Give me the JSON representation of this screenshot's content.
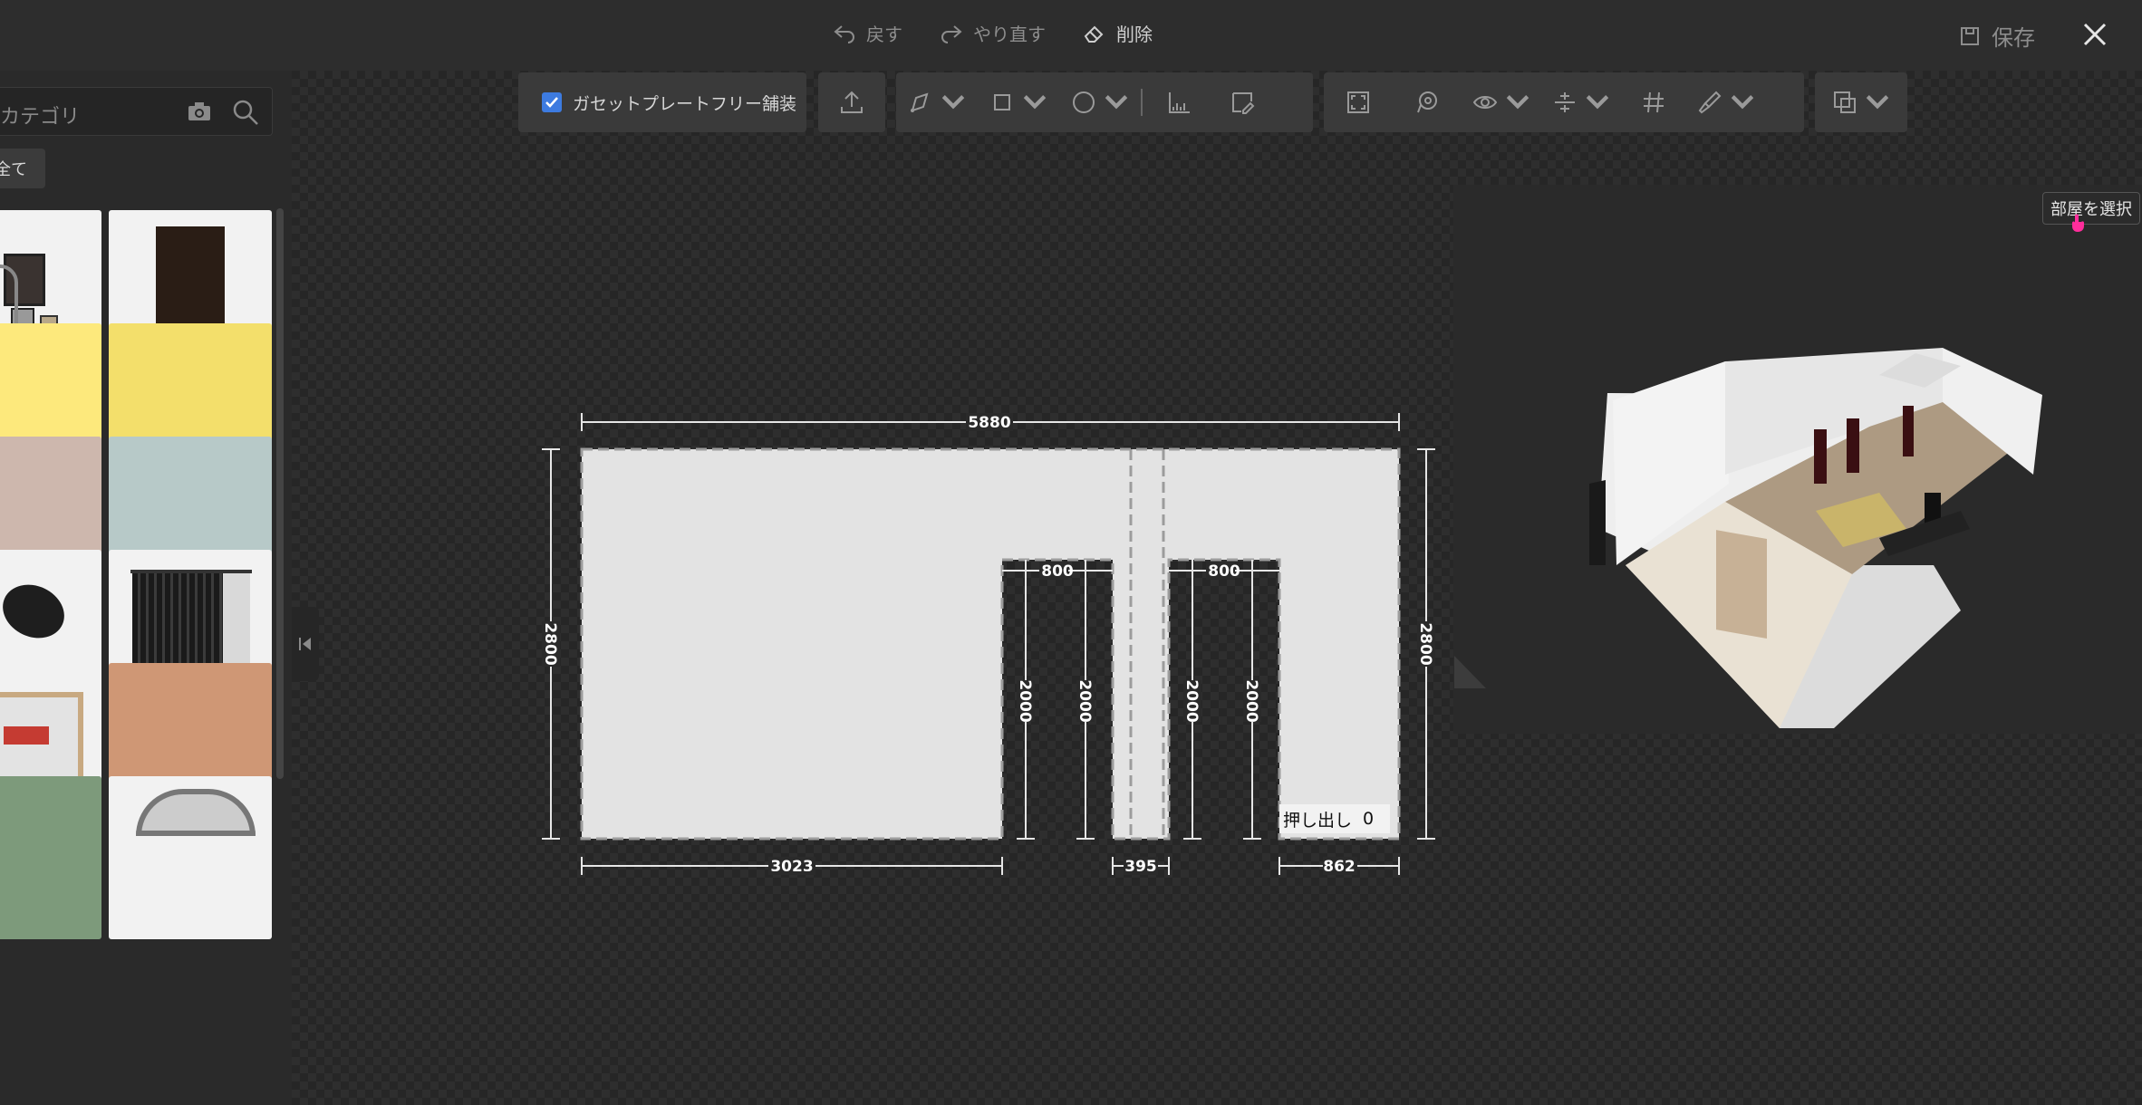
{
  "topbar": {
    "undo_label": "戻す",
    "redo_label": "やり直す",
    "delete_label": "削除",
    "save_label": "保存"
  },
  "sidebar": {
    "search_placeholder": "カテゴリ",
    "chip_label": "全て"
  },
  "toolbar": {
    "gusset_label": "ガセットプレートフリー舗装",
    "gusset_checked": true
  },
  "preview": {
    "room_select_label": "部屋を選択"
  },
  "plan": {
    "top_width": "5880",
    "left_height": "2800",
    "right_height": "2800",
    "door1_width": "800",
    "door2_width": "800",
    "door1_left_height": "2000",
    "door1_right_height": "2000",
    "door2_left_height": "2000",
    "door2_right_height": "2000",
    "seg1_width": "3023",
    "seg2_width": "395",
    "seg3_width": "862",
    "extrude_label": "押し出し",
    "extrude_value": "0"
  },
  "colors": {
    "accent": "#3d7be0",
    "wall": "#e3e3e3",
    "cursor": "#ff2d9b"
  }
}
